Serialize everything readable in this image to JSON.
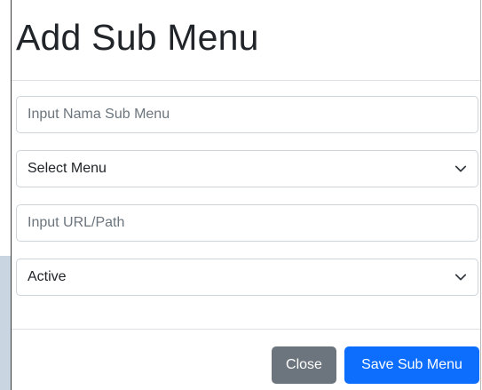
{
  "modal": {
    "title": "Add Sub Menu",
    "fields": {
      "sub_menu_name": {
        "value": "",
        "placeholder": "Input Nama Sub Menu"
      },
      "menu_select": {
        "selected": "Select Menu"
      },
      "url_path": {
        "value": "",
        "placeholder": "Input URL/Path"
      },
      "status_select": {
        "selected": "Active"
      }
    },
    "footer": {
      "close_label": "Close",
      "save_label": "Save Sub Menu"
    }
  },
  "icons": {
    "select_menu_arrow": "chevron-down-icon",
    "status_arrow": "chevron-down-icon"
  },
  "colors": {
    "close_button": "#6c757d",
    "save_button": "#0d6efd",
    "field_border": "#ced4da",
    "placeholder": "#6c757d",
    "title": "#212529"
  }
}
